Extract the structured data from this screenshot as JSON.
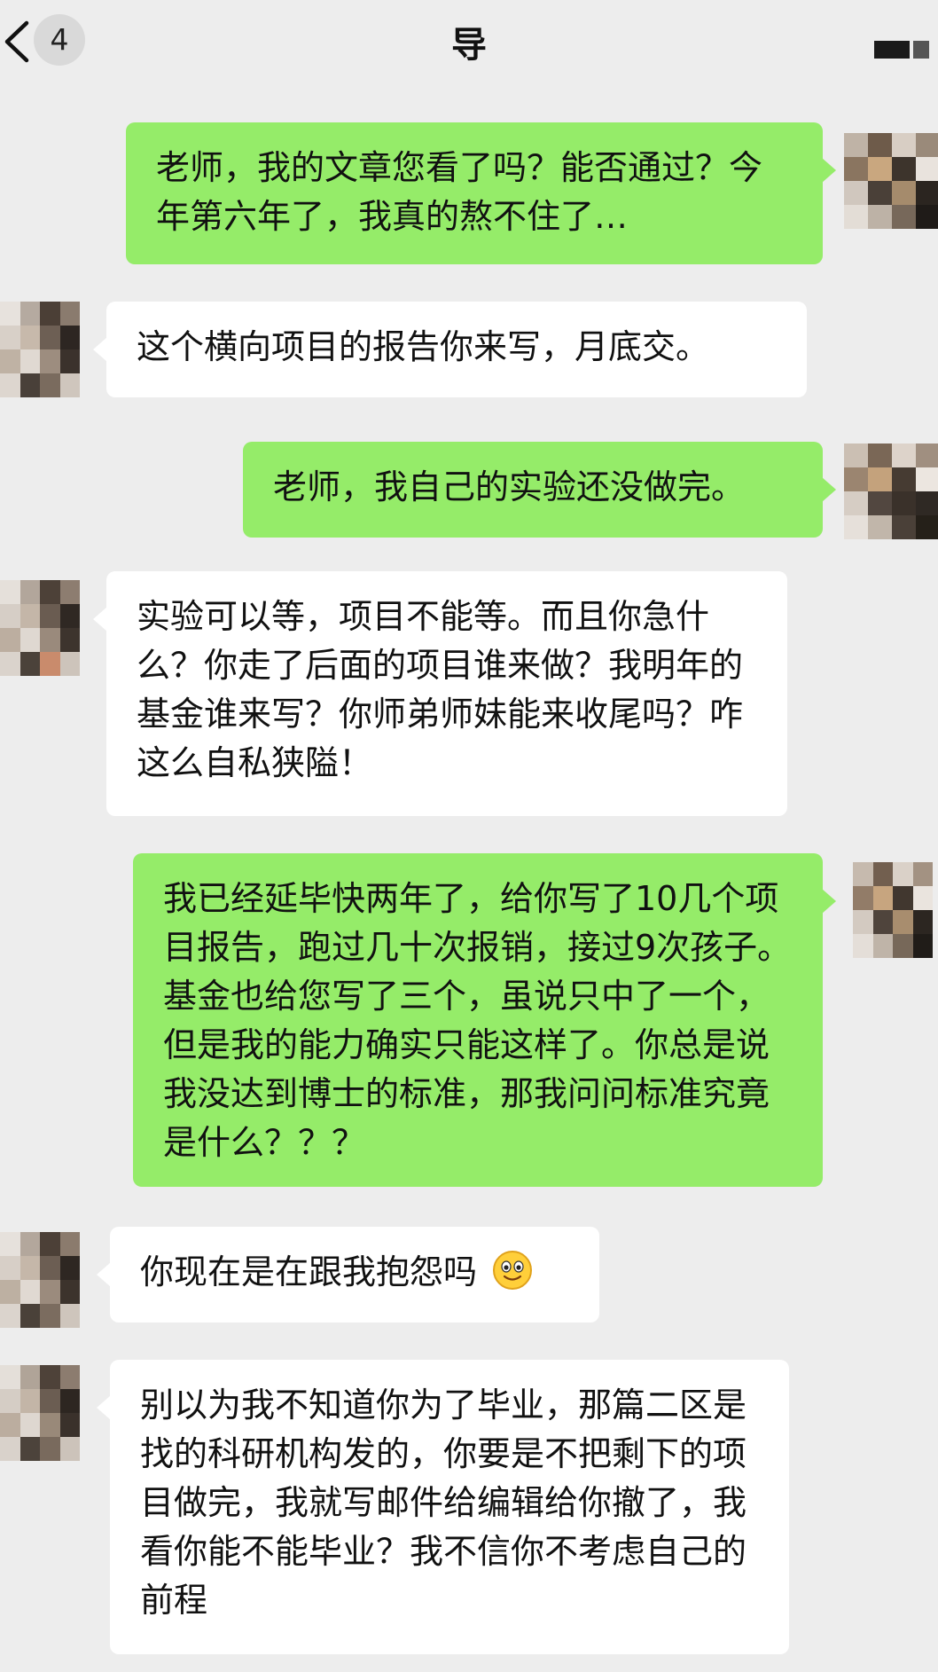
{
  "header": {
    "back_icon": "chevron-left-icon",
    "unread_count": "4",
    "title": "导",
    "more_icon": "more-icon"
  },
  "colors": {
    "background": "#ededed",
    "sent_bubble": "#95ec69",
    "received_bubble": "#ffffff"
  },
  "messages": [
    {
      "side": "sent",
      "text": "老师，我的文章您看了吗？能否通过？今年第六年了，我真的熬不住了…"
    },
    {
      "side": "received",
      "text": "这个横向项目的报告你来写，月底交。"
    },
    {
      "side": "sent",
      "text": "老师，我自己的实验还没做完。"
    },
    {
      "side": "received",
      "text": "实验可以等，项目不能等。而且你急什么？你走了后面的项目谁来做？我明年的基金谁来写？你师弟师妹能来收尾吗？咋这么自私狭隘！"
    },
    {
      "side": "sent",
      "text": "我已经延毕快两年了，给你写了10几个项目报告，跑过几十次报销，接过9次孩子。基金也给您写了三个，虽说只中了一个，但是我的能力确实只能这样了。你总是说我没达到博士的标准，那我问问标准究竟是什么？？？"
    },
    {
      "side": "received",
      "text": "你现在是在跟我抱怨吗",
      "emoji": "smile-emoji-icon"
    },
    {
      "side": "received",
      "text": "别以为我不知道你为了毕业，那篇二区是找的科研机构发的，你要是不把剩下的项目做完，我就写邮件给编辑给你撤了，我看你能不能毕业？我不信你不考虑自己的前程"
    }
  ]
}
